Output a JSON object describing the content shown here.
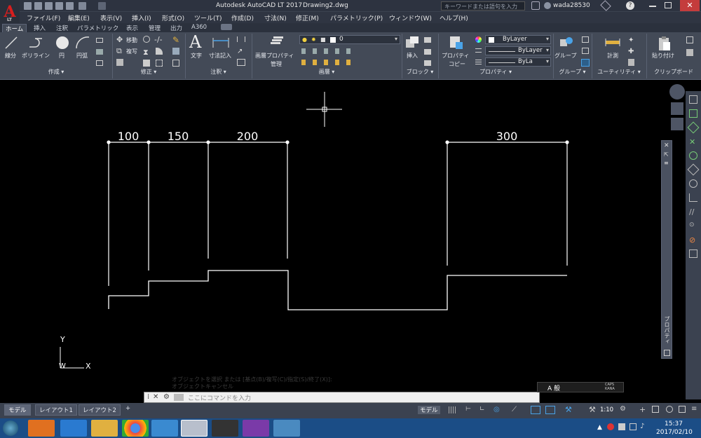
{
  "window": {
    "title": "Autodesk AutoCAD LT 2017",
    "filename": "Drawing2.dwg",
    "search_placeholder": "キーワードまたは語句を入力",
    "user": "wada28530"
  },
  "app_button": {
    "letter": "A",
    "sub": "LT"
  },
  "menus": [
    "ファイル(F)",
    "編集(E)",
    "表示(V)",
    "挿入(I)",
    "形式(O)",
    "ツール(T)",
    "作成(D)",
    "寸法(N)",
    "修正(M)",
    "パラメトリック(P)",
    "ウィンドウ(W)",
    "ヘルプ(H)"
  ],
  "ribbon_tabs": [
    "ホーム",
    "挿入",
    "注釈",
    "パラメトリック",
    "表示",
    "管理",
    "出力",
    "A360"
  ],
  "ribbon": {
    "draw": {
      "line": "線分",
      "polyline": "ポリライン",
      "circle": "円",
      "arc": "円弧",
      "panel": "作成"
    },
    "modify": {
      "move": "移動",
      "copy": "複写",
      "panel": "修正"
    },
    "annotation": {
      "text": "文字",
      "dimension": "寸法記入",
      "panel": "注釈"
    },
    "layers": {
      "properties": "画層プロパティ",
      "manage": "管理",
      "current_layer": "0",
      "panel": "画層"
    },
    "block": {
      "insert": "挿入",
      "panel": "ブロック"
    },
    "properties": {
      "match": "プロパティ",
      "match2": "コピー",
      "color": "ByLayer",
      "linetype": "ByLayer",
      "lineweight": "ByLa",
      "panel": "プロパティ"
    },
    "groups": {
      "group": "グループ",
      "panel": "グループ"
    },
    "utilities": {
      "measure": "計測",
      "panel": "ユーティリティ"
    },
    "clipboard": {
      "paste": "貼り付け",
      "panel": "クリップボード"
    }
  },
  "drawing": {
    "dimensions": [
      "100",
      "150",
      "200",
      "300"
    ],
    "ucs": {
      "x": "X",
      "y": "Y",
      "w": "W"
    }
  },
  "command": {
    "history": "オブジェクトを選択 または [基点(B)/複写(C)/指定(S)/終了(X)]:",
    "history2": "オブジェクトキャンセル",
    "placeholder": "ここにコマンドを入力"
  },
  "layout_tabs": [
    "モデル",
    "レイアウト1",
    "レイアウト2"
  ],
  "status": {
    "model": "モデル",
    "scale": "1:10"
  },
  "properties_strip": "プロパティ",
  "clock": {
    "time": "15:37",
    "date": "2017/02/10"
  },
  "ime": {
    "mode": "A 般",
    "caps": "CAPS KANA"
  }
}
